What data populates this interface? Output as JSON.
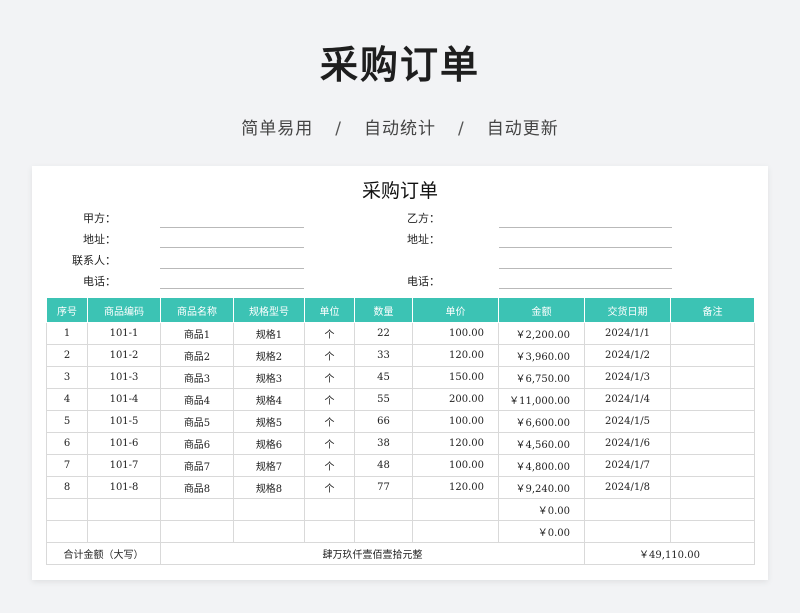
{
  "header": {
    "title": "采购订单",
    "tagline": [
      "简单易用",
      "自动统计",
      "自动更新"
    ],
    "separator": "/"
  },
  "document": {
    "title": "采购订单",
    "fields_left": [
      "甲方：",
      "地址：",
      "联系人：",
      "电话："
    ],
    "fields_right": [
      "乙方：",
      "地址：",
      "",
      "电话："
    ]
  },
  "table": {
    "headers": [
      "序号",
      "商品编码",
      "商品名称",
      "规格型号",
      "单位",
      "数量",
      "单价",
      "金额",
      "交货日期",
      "备注"
    ],
    "rows": [
      [
        "1",
        "101-1",
        "商品1",
        "规格1",
        "个",
        "22",
        "100.00",
        "￥2,200.00",
        "2024/1/1",
        ""
      ],
      [
        "2",
        "101-2",
        "商品2",
        "规格2",
        "个",
        "33",
        "120.00",
        "￥3,960.00",
        "2024/1/2",
        ""
      ],
      [
        "3",
        "101-3",
        "商品3",
        "规格3",
        "个",
        "45",
        "150.00",
        "￥6,750.00",
        "2024/1/3",
        ""
      ],
      [
        "4",
        "101-4",
        "商品4",
        "规格4",
        "个",
        "55",
        "200.00",
        "￥11,000.00",
        "2024/1/4",
        ""
      ],
      [
        "5",
        "101-5",
        "商品5",
        "规格5",
        "个",
        "66",
        "100.00",
        "￥6,600.00",
        "2024/1/5",
        ""
      ],
      [
        "6",
        "101-6",
        "商品6",
        "规格6",
        "个",
        "38",
        "120.00",
        "￥4,560.00",
        "2024/1/6",
        ""
      ],
      [
        "7",
        "101-7",
        "商品7",
        "规格7",
        "个",
        "48",
        "100.00",
        "￥4,800.00",
        "2024/1/7",
        ""
      ],
      [
        "8",
        "101-8",
        "商品8",
        "规格8",
        "个",
        "77",
        "120.00",
        "￥9,240.00",
        "2024/1/8",
        ""
      ],
      [
        "",
        "",
        "",
        "",
        "",
        "",
        "",
        "￥0.00",
        "",
        ""
      ],
      [
        "",
        "",
        "",
        "",
        "",
        "",
        "",
        "￥0.00",
        "",
        ""
      ]
    ],
    "total_label": "合计金额（大写）",
    "total_words": "肆万玖仟壹佰壹拾元整",
    "total_amount": "￥49,110.00"
  },
  "colors": {
    "header_bg": "#3cc3b4",
    "page_bg": "#f2f3f5"
  }
}
